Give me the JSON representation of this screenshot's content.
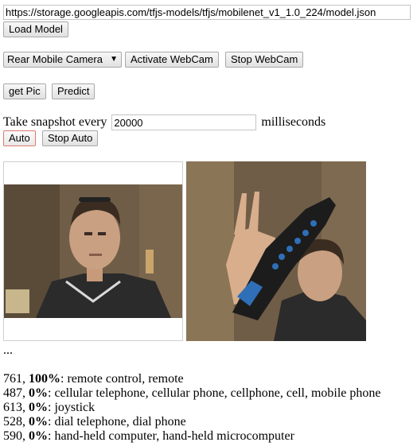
{
  "model_url": "https://storage.googleapis.com/tfjs-models/tfjs/mobilenet_v1_1.0_224/model.json",
  "buttons": {
    "load_model": "Load Model",
    "activate_webcam": "Activate WebCam",
    "stop_webcam": "Stop WebCam",
    "get_pic": "get Pic",
    "predict": "Predict",
    "auto": "Auto",
    "stop_auto": "Stop Auto"
  },
  "camera_select": {
    "selected": "Rear Mobile Camera"
  },
  "snapshot": {
    "prefix": "Take snapshot every",
    "value": "20000",
    "suffix": "milliseconds"
  },
  "status": "...",
  "predictions": [
    {
      "id": "761",
      "prob": "100%",
      "label": ": remote control, remote"
    },
    {
      "id": "487",
      "prob": "0%",
      "label": ": cellular telephone, cellular phone, cellphone, cell, mobile phone"
    },
    {
      "id": "613",
      "prob": "0%",
      "label": ": joystick"
    },
    {
      "id": "528",
      "prob": "0%",
      "label": ": dial telephone, dial phone"
    },
    {
      "id": "590",
      "prob": "0%",
      "label": ": hand-held computer, hand-held microcomputer"
    }
  ],
  "icons": {
    "select_arrow": "chevron-down-icon"
  }
}
